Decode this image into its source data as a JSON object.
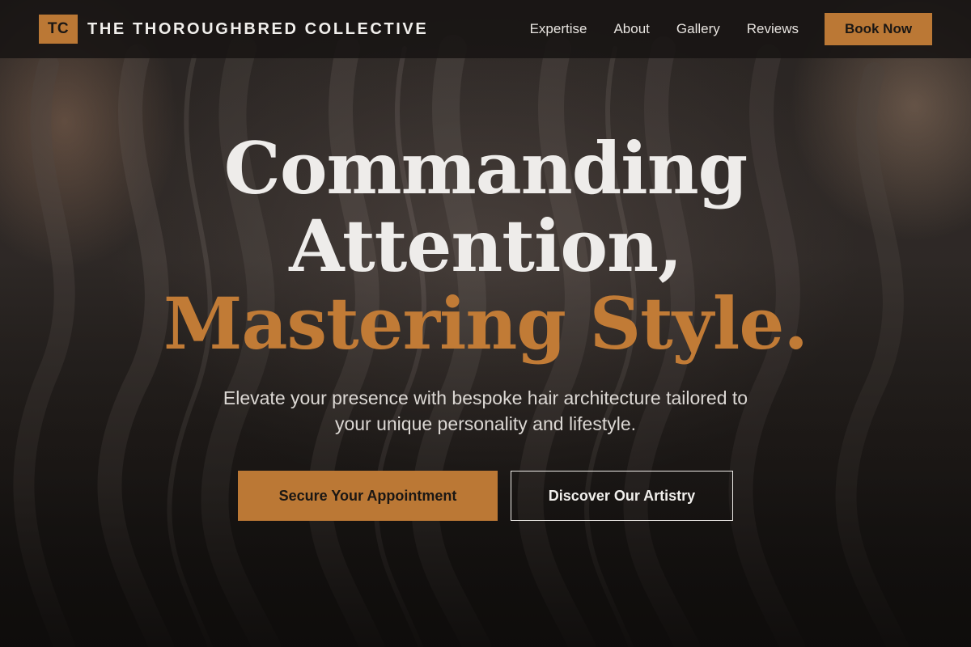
{
  "nav": {
    "logo_mark": "TC",
    "brand_name": "THE THOROUGHBRED COLLECTIVE",
    "links": [
      {
        "label": "Expertise"
      },
      {
        "label": "About"
      },
      {
        "label": "Gallery"
      },
      {
        "label": "Reviews"
      }
    ],
    "book_label": "Book Now"
  },
  "hero": {
    "headline_line1": "Commanding",
    "headline_line2": "Attention,",
    "headline_accent": "Mastering Style.",
    "subtitle": "Elevate your presence with bespoke hair architecture tailored to your unique personality and lifestyle.",
    "primary_cta": "Secure Your Appointment",
    "secondary_cta": "Discover Our Artistry"
  },
  "colors": {
    "accent": "#bb7835",
    "background": "#1a1716",
    "text": "#eeecea"
  }
}
